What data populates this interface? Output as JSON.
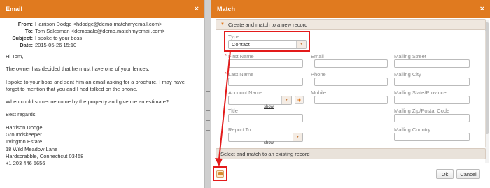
{
  "email": {
    "title": "Email",
    "close": "×",
    "from_label": "From:",
    "from_value": "Harrison Dodge <hdodge@demo.matchmyemail.com>",
    "to_label": "To:",
    "to_value": "Tom Salesman <demosale@demo.matchmyemail.com>",
    "subject_label": "Subject:",
    "subject_value": "I spoke to your boss",
    "date_label": "Date:",
    "date_value": "2015-05-26 15:10",
    "body": [
      "Hi Tom,",
      "The owner has decided that he must have one of your fences.",
      "I spoke to your boss and sent him an email asking for a brochure.  I may have forgot to mention that you and I had talked on the phone.",
      "When could someone come by the property and give me an estimate?",
      "Best regards."
    ],
    "signature": [
      "Harrison Dodge",
      "Groundskeeper",
      "Irvington Estate",
      "18 Wild Meadow Lane",
      "Hardscrabble, Connecticut 03458",
      "+1 203 446 5656"
    ]
  },
  "match": {
    "title": "Match",
    "close": "×",
    "create_section": "Create and match to a new record",
    "existing_section": "Select and match to an existing record",
    "type_label": "Type",
    "type_value": "Contact",
    "fields": {
      "first_name": "First Name",
      "last_name": "Last Name",
      "account_name": "Account Name",
      "title": "Title",
      "report_to": "Report To",
      "email": "Email",
      "phone": "Phone",
      "mobile": "Mobile",
      "mailing_street": "Mailing Street",
      "mailing_city": "Mailing City",
      "mailing_state": "Mailing State/Province",
      "mailing_zip": "Mailing Zip/Postal Code",
      "mailing_country": "Mailing Country"
    },
    "show_link": "show",
    "plus": "+",
    "ok_label": "Ok",
    "cancel_label": "Cancel"
  },
  "colors": {
    "accent": "#e07a1f",
    "highlight": "#e31b1b"
  }
}
